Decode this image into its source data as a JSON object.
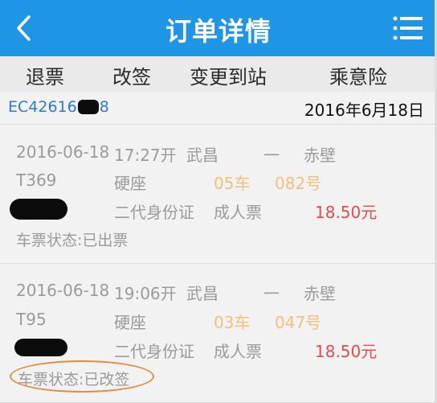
{
  "header": {
    "title": "订单详情",
    "icons": {
      "back": "chevron-left-icon",
      "menu": "list-menu-icon"
    },
    "colors": {
      "bar": "#1f95e6",
      "text": "#ffffff"
    }
  },
  "actions": {
    "refund": "退票",
    "change": "改签",
    "change_station": "变更到站",
    "insurance": "乘意险"
  },
  "order": {
    "number": "EC42616",
    "number_end": "8",
    "date": "2016年6月18日"
  },
  "tickets": [
    {
      "date": "2016-06-18",
      "time": "17:27开",
      "from": "武昌",
      "dash": "一",
      "to": "赤壁",
      "train": "T369",
      "seat_type": "硬座",
      "car": "05车",
      "seat_no": "082号",
      "id_type": "二代身份证",
      "ticket_type": "成人票",
      "price": "18.50元",
      "status": "车票状态:已出票"
    },
    {
      "date": "2016-06-18",
      "time": "19:06开",
      "from": "武昌",
      "dash": "一",
      "to": "赤壁",
      "train": "T95",
      "seat_type": "硬座",
      "car": "03车",
      "seat_no": "047号",
      "id_type": "二代身份证",
      "ticket_type": "成人票",
      "price": "18.50元",
      "status": "车票状态:已改签"
    }
  ],
  "colors": {
    "muted_text": "#9b9b9b",
    "car_seat": "#f3c07a",
    "price": "#e64b4b",
    "order_no": "#2d79d6",
    "highlight_ellipse": "#e58a3a"
  }
}
